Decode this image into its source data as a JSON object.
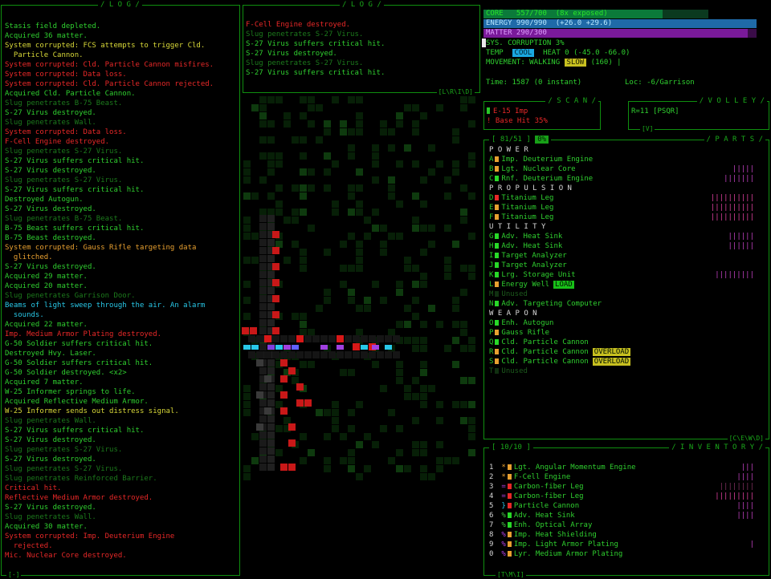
{
  "log_main": {
    "title": "/ L O G /",
    "footer": "[-]",
    "lines": [
      {
        "t": "Stasis field depleted.",
        "c": "g"
      },
      {
        "t": "Acquired 36 matter.",
        "c": "g"
      },
      {
        "t": "System corrupted: FCS attempts to trigger Cld.",
        "c": "y"
      },
      {
        "t": "  Particle Cannon.",
        "c": "y"
      },
      {
        "t": "System corrupted: Cld. Particle Cannon misfires.",
        "c": "r"
      },
      {
        "t": "System corrupted: Data loss.",
        "c": "r"
      },
      {
        "t": "System corrupted: Cld. Particle Cannon rejected.",
        "c": "r"
      },
      {
        "t": "Acquired Cld. Particle Cannon.",
        "c": "g"
      },
      {
        "t": "Slug penetrates B-75 Beast.",
        "c": "d"
      },
      {
        "t": "S-27 Virus destroyed.",
        "c": "g"
      },
      {
        "t": "Slug penetrates Wall.",
        "c": "d"
      },
      {
        "t": "System corrupted: Data loss.",
        "c": "r"
      },
      {
        "t": "F-Cell Engine destroyed.",
        "c": "r"
      },
      {
        "t": "Slug penetrates S-27 Virus.",
        "c": "d"
      },
      {
        "t": "S-27 Virus suffers critical hit.",
        "c": "g"
      },
      {
        "t": "S-27 Virus destroyed.",
        "c": "g"
      },
      {
        "t": "Slug penetrates S-27 Virus.",
        "c": "d"
      },
      {
        "t": "S-27 Virus suffers critical hit.",
        "c": "g"
      },
      {
        "t": "Destroyed Autogun.",
        "c": "g"
      },
      {
        "t": "S-27 Virus destroyed.",
        "c": "g"
      },
      {
        "t": "Slug penetrates B-75 Beast.",
        "c": "d"
      },
      {
        "t": "B-75 Beast suffers critical hit.",
        "c": "g"
      },
      {
        "t": "B-75 Beast destroyed.",
        "c": "g"
      },
      {
        "t": "System corrupted: Gauss Rifle targeting data",
        "c": "o"
      },
      {
        "t": "  glitched.",
        "c": "o"
      },
      {
        "t": "S-27 Virus destroyed.",
        "c": "g"
      },
      {
        "t": "Acquired 29 matter.",
        "c": "g"
      },
      {
        "t": "Acquired 20 matter.",
        "c": "g"
      },
      {
        "t": "Slug penetrates Garrison Door.",
        "c": "d"
      },
      {
        "t": "Beams of light sweep through the air. An alarm",
        "c": "c"
      },
      {
        "t": "  sounds.",
        "c": "c"
      },
      {
        "t": "Acquired 22 matter.",
        "c": "g"
      },
      {
        "t": "Imp. Medium Armor Plating destroyed.",
        "c": "r"
      },
      {
        "t": "G-50 Soldier suffers critical hit.",
        "c": "g"
      },
      {
        "t": "Destroyed Hvy. Laser.",
        "c": "g"
      },
      {
        "t": "G-50 Soldier suffers critical hit.",
        "c": "g"
      },
      {
        "t": "G-50 Soldier destroyed. <x2>",
        "c": "g"
      },
      {
        "t": "Acquired 7 matter.",
        "c": "g"
      },
      {
        "t": "W-25 Informer springs to life.",
        "c": "g"
      },
      {
        "t": "Acquired Reflective Medium Armor.",
        "c": "g"
      },
      {
        "t": "W-25 Informer sends out distress signal.",
        "c": "y"
      },
      {
        "t": "Slug penetrates Wall.",
        "c": "d"
      },
      {
        "t": "S-27 Virus suffers critical hit.",
        "c": "g"
      },
      {
        "t": "S-27 Virus destroyed.",
        "c": "g"
      },
      {
        "t": "Slug penetrates S-27 Virus.",
        "c": "d"
      },
      {
        "t": "S-27 Virus destroyed.",
        "c": "g"
      },
      {
        "t": "Slug penetrates S-27 Virus.",
        "c": "d"
      },
      {
        "t": "Slug penetrates Reinforced Barrier.",
        "c": "d"
      },
      {
        "t": "Critical hit.",
        "c": "r"
      },
      {
        "t": "Reflective Medium Armor destroyed.",
        "c": "r"
      },
      {
        "t": "S-27 Virus destroyed.",
        "c": "g"
      },
      {
        "t": "Slug penetrates Wall.",
        "c": "d"
      },
      {
        "t": "Acquired 30 matter.",
        "c": "g"
      },
      {
        "t": "System corrupted: Imp. Deuterium Engine",
        "c": "r"
      },
      {
        "t": "  rejected.",
        "c": "r"
      },
      {
        "t": "Mic. Nuclear Core destroyed.",
        "c": "r"
      }
    ]
  },
  "log_recent": {
    "title": "/ L O G /",
    "footer": "[L\\R\\I\\D]",
    "lines": [
      {
        "t": "F-Cell Engine destroyed.",
        "c": "r"
      },
      {
        "t": "Slug penetrates S-27 Virus.",
        "c": "d"
      },
      {
        "t": "S-27 Virus suffers critical hit.",
        "c": "g"
      },
      {
        "t": "S-27 Virus destroyed.",
        "c": "g"
      },
      {
        "t": "Slug penetrates S-27 Virus.",
        "c": "d"
      },
      {
        "t": "S-27 Virus suffers critical hit.",
        "c": "g"
      }
    ]
  },
  "status": {
    "core": "CORE   557/700  (8x exposed)",
    "core_frac": 0.796,
    "energy": "ENERGY 990/990  (+26.0 +29.6)",
    "energy_frac": 1.0,
    "matter": "MATTER 290/300",
    "matter_frac": 0.967,
    "sys": "SYS. CORRUPTION 3%",
    "temp_label": "TEMP",
    "temp_state": "COOL",
    "heat": "HEAT 0 (-45.0 -66.0)",
    "movement_label": "MOVEMENT: WALKING",
    "movement_state": "SLOW",
    "movement_speed": "(160)",
    "time": "Time: 1587 (0 instant)",
    "location": "Loc: -6/Garrison"
  },
  "scan": {
    "title": "/ S C A N /",
    "line1": "E-15 Imp",
    "line2": "! Base Hit 35%"
  },
  "volley": {
    "title": "/ V O L L E Y /",
    "line1": "R=11 [PSQR]",
    "footer": "[V]"
  },
  "parts": {
    "title": "/ P A R T S /",
    "slots": "[ 81/51 ]",
    "slots_extra": "0%",
    "footer": "[C\\E\\W\\D]",
    "groups": [
      {
        "name": "P O W E R",
        "items": [
          {
            "key": "A",
            "name": "Imp. Deuterium Engine",
            "color": "#e8a030",
            "ticks": "",
            "tickColor": "#c040c0"
          },
          {
            "key": "B",
            "name": "Lgt. Nuclear Core",
            "color": "#e8a030",
            "ticks": "|||||",
            "tickColor": "#c040c0"
          },
          {
            "key": "C",
            "name": "Rnf. Deuterium Engine",
            "color": "#28d828",
            "ticks": "|||||||",
            "tickColor": "#c040c0"
          }
        ]
      },
      {
        "name": "P R O P U L S I O N",
        "items": [
          {
            "key": "D",
            "name": "Titanium Leg",
            "color": "#e82828",
            "ticks": "||||||||||",
            "tickColor": "#e040a0"
          },
          {
            "key": "E",
            "name": "Titanium Leg",
            "color": "#e8a030",
            "ticks": "||||||||||",
            "tickColor": "#e040a0"
          },
          {
            "key": "F",
            "name": "Titanium Leg",
            "color": "#e8a030",
            "ticks": "||||||||||",
            "tickColor": "#e040a0"
          }
        ]
      },
      {
        "name": "U T I L I T Y",
        "items": [
          {
            "key": "G",
            "name": "Adv. Heat Sink",
            "color": "#28d828",
            "ticks": "||||||",
            "tickColor": "#c040c0"
          },
          {
            "key": "H",
            "name": "Adv. Heat Sink",
            "color": "#28d828",
            "ticks": "||||||",
            "tickColor": "#c040c0"
          },
          {
            "key": "I",
            "name": "Target Analyzer",
            "color": "#28d828",
            "ticks": "",
            "tickColor": "#c040c0"
          },
          {
            "key": "J",
            "name": "Target Analyzer",
            "color": "#28d828",
            "ticks": "",
            "tickColor": "#c040c0"
          },
          {
            "key": "K",
            "name": "Lrg. Storage Unit",
            "color": "#28d828",
            "ticks": "|||||||||",
            "tickColor": "#c040c0"
          },
          {
            "key": "L",
            "name": "Energy Well",
            "color": "#e8a030",
            "ticks": "",
            "tickColor": "#c040c0",
            "tag": "LOAD",
            "tagColor": "#18c018"
          },
          {
            "key": "M",
            "name": "Unused",
            "color": "#103010",
            "ticks": "",
            "tickColor": "#c040c0",
            "dim": true
          },
          {
            "key": "N",
            "name": "Adv. Targeting Computer",
            "color": "#28d828",
            "ticks": "",
            "tickColor": "#c040c0"
          }
        ]
      },
      {
        "name": "W E A P O N",
        "items": [
          {
            "key": "O",
            "name": "Enh. Autogun",
            "color": "#28d828",
            "ticks": "",
            "tickColor": "#c040c0"
          },
          {
            "key": "P",
            "name": "Gauss Rifle",
            "color": "#e8a030",
            "ticks": "",
            "tickColor": "#c040c0"
          },
          {
            "key": "Q",
            "name": "Cld. Particle Cannon",
            "color": "#28d828",
            "ticks": "",
            "tickColor": "#c040c0"
          },
          {
            "key": "R",
            "name": "Cld. Particle Cannon",
            "color": "#e8a030",
            "ticks": "",
            "tickColor": "#c040c0",
            "tag": "OVERLOAD",
            "tagColor": "#c8c020"
          },
          {
            "key": "S",
            "name": "Cld. Particle Cannon",
            "color": "#e8a030",
            "ticks": "",
            "tickColor": "#c040c0",
            "tag": "OVERLOAD",
            "tagColor": "#c8c020"
          },
          {
            "key": "T",
            "name": "Unused",
            "color": "#103010",
            "ticks": "",
            "tickColor": "#c040c0",
            "dim": true
          }
        ]
      }
    ]
  },
  "inventory": {
    "title": "/ I N V E N T O R Y /",
    "slots": "[ 10/10 ]",
    "footer": "[T\\M\\I]",
    "items": [
      {
        "key": "1",
        "glyph": "*",
        "glyphColor": "#e8a030",
        "name": "Lgt. Angular Momentum Engine",
        "color": "#e8a030",
        "ticks": "|||",
        "tickColor": "#c040c0"
      },
      {
        "key": "2",
        "glyph": "*",
        "glyphColor": "#e8a030",
        "name": "F-Cell Engine",
        "color": "#e8a030",
        "ticks": "||||",
        "tickColor": "#c040c0"
      },
      {
        "key": "3",
        "glyph": "=",
        "glyphColor": "#b040e0",
        "name": "Carbon-fiber Leg",
        "color": "#e82828",
        "ticks": "||||||||",
        "tickColor": "#803060"
      },
      {
        "key": "4",
        "glyph": "=",
        "glyphColor": "#b040e0",
        "name": "Carbon-fiber Leg",
        "color": "#e82828",
        "ticks": "|||||||||",
        "tickColor": "#e040a0"
      },
      {
        "key": "5",
        "glyph": "}",
        "glyphColor": "#28c8e8",
        "name": "Particle Cannon",
        "color": "#e82828",
        "ticks": "||||",
        "tickColor": "#c040c0"
      },
      {
        "key": "6",
        "glyph": "%",
        "glyphColor": "#40c040",
        "name": "Adv. Heat Sink",
        "color": "#28d828",
        "ticks": "||||",
        "tickColor": "#c040c0"
      },
      {
        "key": "7",
        "glyph": "%",
        "glyphColor": "#40c040",
        "name": "Enh. Optical Array",
        "color": "#28d828",
        "ticks": "",
        "tickColor": "#c040c0"
      },
      {
        "key": "8",
        "glyph": "%",
        "glyphColor": "#b040e0",
        "name": "Imp. Heat Shielding",
        "color": "#e8a030",
        "ticks": "",
        "tickColor": "#c040c0"
      },
      {
        "key": "9",
        "glyph": "%",
        "glyphColor": "#b040e0",
        "name": "Imp. Light Armor Plating",
        "color": "#e8a030",
        "ticks": "|",
        "tickColor": "#c040c0"
      },
      {
        "key": "0",
        "glyph": "%",
        "glyphColor": "#b040e0",
        "name": "Lyr. Medium Armor Plating",
        "color": "#e8a030",
        "ticks": "",
        "tickColor": "#c040c0"
      }
    ]
  },
  "colors": {
    "frame": "#0f8f0f",
    "core_bar": "#0b7a3a",
    "energy_bar": "#1f6aa8",
    "matter_bar": "#7a1a9a",
    "temp_bg": "#1aa8e0",
    "slow_bg": "#c8c020"
  }
}
